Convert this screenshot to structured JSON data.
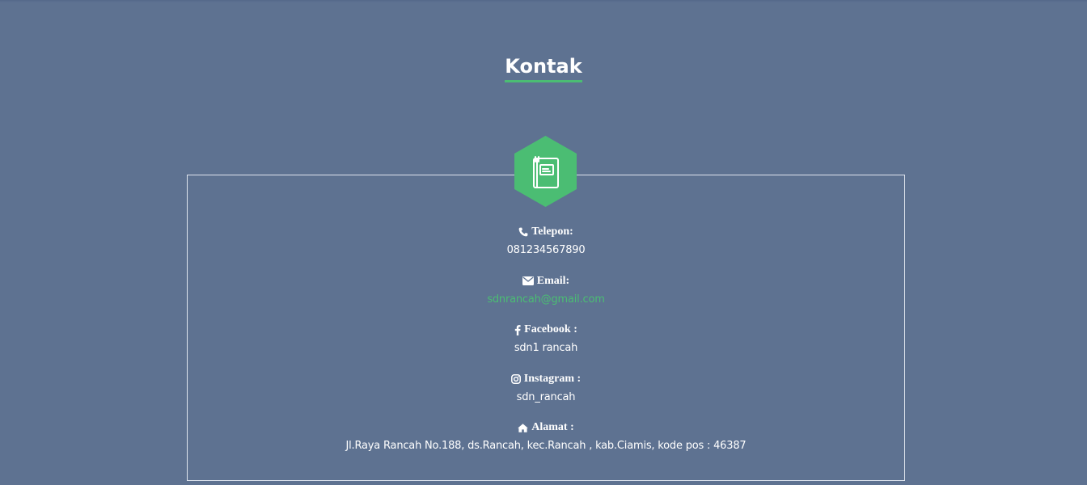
{
  "section": {
    "title": "Kontak"
  },
  "icons": {
    "header": "book-icon",
    "accent_color": "#4bbd73"
  },
  "contacts": [
    {
      "icon": "phone-icon",
      "label": "Telepon:",
      "value": "081234567890"
    },
    {
      "icon": "envelope-icon",
      "label": "Email:",
      "value": "sdnrancah@gmail.com"
    },
    {
      "icon": "facebook-icon",
      "label": "Facebook :",
      "value": "sdn1 rancah"
    },
    {
      "icon": "instagram-icon",
      "label": "Instagram :",
      "value": "sdn_rancah"
    },
    {
      "icon": "home-icon",
      "label": "Alamat :",
      "value": "Jl.Raya Rancah No.188, ds.Rancah, kec.Rancah , kab.Ciamis, kode pos : 46387"
    }
  ],
  "colors": {
    "background": "#5e7291",
    "accent": "#4bbd73",
    "text": "#ffffff",
    "border": "#dfe5ee"
  }
}
